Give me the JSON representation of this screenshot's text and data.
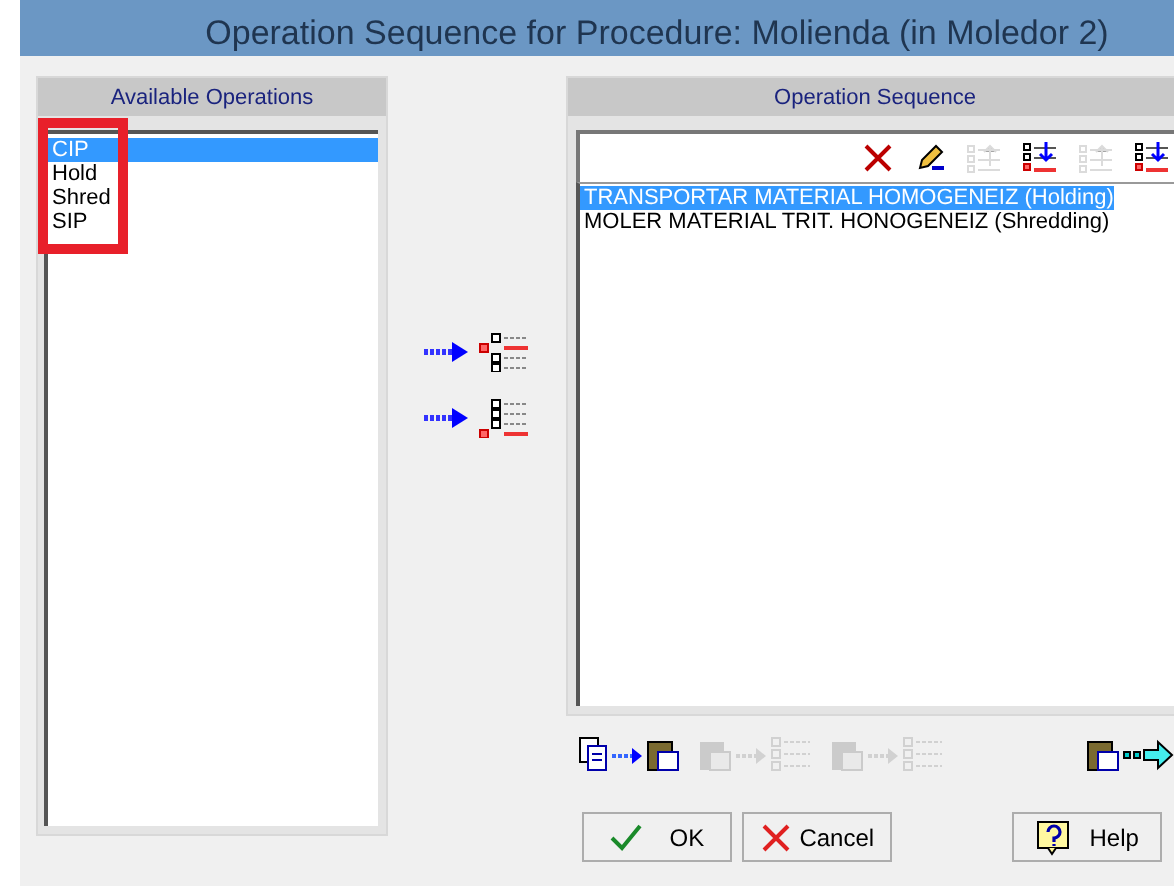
{
  "window": {
    "title": "Operation Sequence for Procedure: Molienda (in Moledor 2)"
  },
  "available": {
    "header": "Available Operations",
    "items": [
      {
        "label": "CIP",
        "selected": true
      },
      {
        "label": "Hold",
        "selected": false
      },
      {
        "label": "Shred",
        "selected": false
      },
      {
        "label": "SIP",
        "selected": false
      }
    ]
  },
  "transfer_buttons": [
    {
      "kind": "insert-before"
    },
    {
      "kind": "append"
    }
  ],
  "sequence": {
    "header": "Operation Sequence",
    "toolbar": [
      {
        "kind": "delete",
        "disabled": false
      },
      {
        "kind": "edit",
        "disabled": false
      },
      {
        "kind": "move-up",
        "disabled": true
      },
      {
        "kind": "move-down",
        "disabled": false
      },
      {
        "kind": "move-up",
        "disabled": true
      },
      {
        "kind": "move-down",
        "disabled": false
      }
    ],
    "items": [
      {
        "label": "TRANSPORTAR MATERIAL HOMOGENEIZ (Holding)",
        "selected": true
      },
      {
        "label": "MOLER MATERIAL TRIT. HONOGENEIZ (Shredding)",
        "selected": false
      }
    ],
    "bottom_tools": [
      {
        "kind": "copy",
        "disabled": false
      },
      {
        "kind": "paste",
        "disabled": true
      },
      {
        "kind": "paste",
        "disabled": true
      },
      {
        "kind": "export",
        "disabled": false
      }
    ]
  },
  "buttons": [
    {
      "kind": "ok",
      "label": "OK"
    },
    {
      "kind": "cancel",
      "label": "Cancel"
    },
    {
      "kind": "help",
      "label": "Help"
    }
  ]
}
